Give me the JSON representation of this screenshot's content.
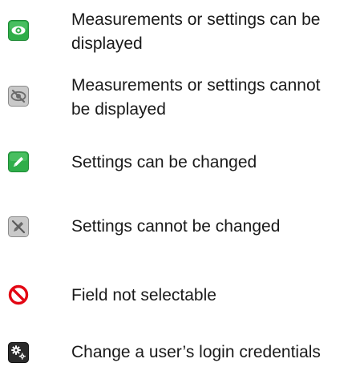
{
  "legend": {
    "items": [
      {
        "icon": "eye-visible-icon",
        "text_line1": "Measurements or settings can be",
        "text_line2": "displayed"
      },
      {
        "icon": "eye-hidden-icon",
        "text_line1": "Measurements or settings cannot",
        "text_line2": "be displayed"
      },
      {
        "icon": "pencil-edit-icon",
        "text_line1": "Settings can be changed"
      },
      {
        "icon": "pencil-disabled-icon",
        "text_line1": "Settings cannot be changed"
      },
      {
        "icon": "prohibited-icon",
        "text_line1": "Field not selectable"
      },
      {
        "icon": "gears-icon",
        "text_line1": "Change a user’s login credentials"
      }
    ]
  },
  "colors": {
    "enabled_green": "#2fae4a",
    "disabled_gray": "#9a9a9a",
    "prohibited_red": "#e30613",
    "gears_dark": "#2b2b2b"
  }
}
